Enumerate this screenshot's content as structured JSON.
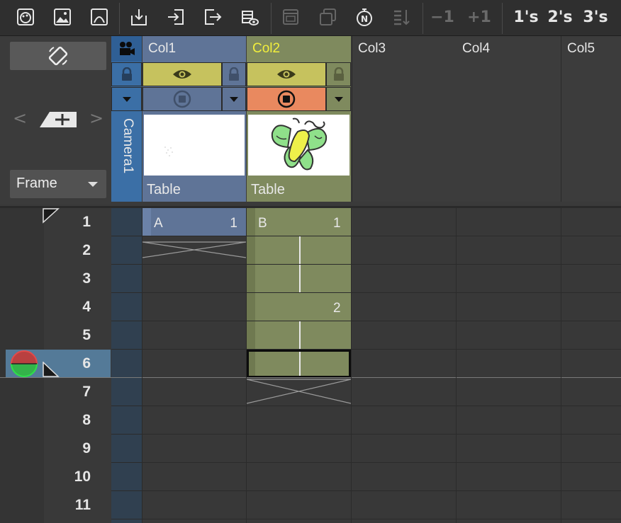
{
  "toolbar": {
    "icons": [
      "palette-icon",
      "image-icon",
      "arc-icon",
      "import-icon",
      "enter-icon",
      "exit-icon",
      "scene-view-icon",
      "window-icon",
      "layers-icon",
      "stopwatch-icon",
      "sort-icon"
    ],
    "minus_one": "−1",
    "plus_one": "+1",
    "ones": "1's",
    "twos": "2's",
    "threes": "3's"
  },
  "left_panel": {
    "frame_label": "Frame"
  },
  "camera_column": {
    "label": "Camera1",
    "color": "#3b6fa6"
  },
  "columns": [
    {
      "name": "Col1",
      "footer": "Table",
      "color": "#5f7497",
      "name_color": "#e8e8e8"
    },
    {
      "name": "Col2",
      "footer": "Table",
      "color": "#7f8a5e",
      "name_color": "#f2ef3c"
    },
    {
      "name": "Col3",
      "footer": ""
    },
    {
      "name": "Col4",
      "footer": ""
    },
    {
      "name": "Col5",
      "footer": ""
    }
  ],
  "rows": [
    "1",
    "2",
    "3",
    "4",
    "5",
    "6",
    "7",
    "8",
    "9",
    "10",
    "11"
  ],
  "current_row": "6",
  "cells": {
    "col1_row1": {
      "level": "A",
      "frame": "1"
    },
    "col2_row1": {
      "level": "B",
      "frame": "1"
    },
    "col2_row4": {
      "frame": "2"
    }
  }
}
